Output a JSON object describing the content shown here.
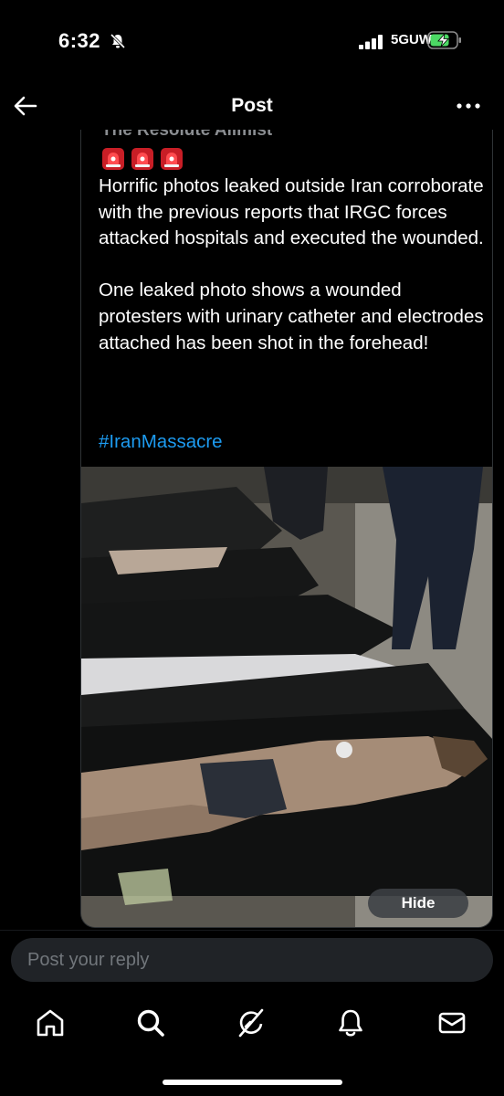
{
  "status_bar": {
    "time": "6:32",
    "network": "5GUW",
    "icons": [
      "mute-icon",
      "signal-icon",
      "battery-charging-icon"
    ]
  },
  "header": {
    "title": "Post",
    "icons": [
      "back-arrow-icon",
      "more-icon"
    ]
  },
  "quoted_post": {
    "author_line": "The Resolute Alimist",
    "emojis": [
      "siren-icon",
      "siren-icon",
      "siren-icon"
    ],
    "body": "Horrific photos leaked outside Iran corroborate with the previous reports that IRGC forces attacked hospitals and executed the wounded.\n\nOne leaked photo shows a wounded protesters with urinary catheter and electrodes attached has been shot in the forehead!",
    "hashtag": "#IranMassacre",
    "media": {
      "hide_label": "Hide"
    }
  },
  "reply": {
    "placeholder": "Post your reply"
  },
  "bottom_nav": {
    "items": [
      "home-icon",
      "search-icon",
      "grok-icon",
      "notifications-icon",
      "messages-icon"
    ]
  },
  "colors": {
    "background": "#000000",
    "text": "#ffffff",
    "link": "#1d9bf0",
    "border": "#2f3336",
    "input_bg": "#202327",
    "siren_red": "#e0262e"
  }
}
